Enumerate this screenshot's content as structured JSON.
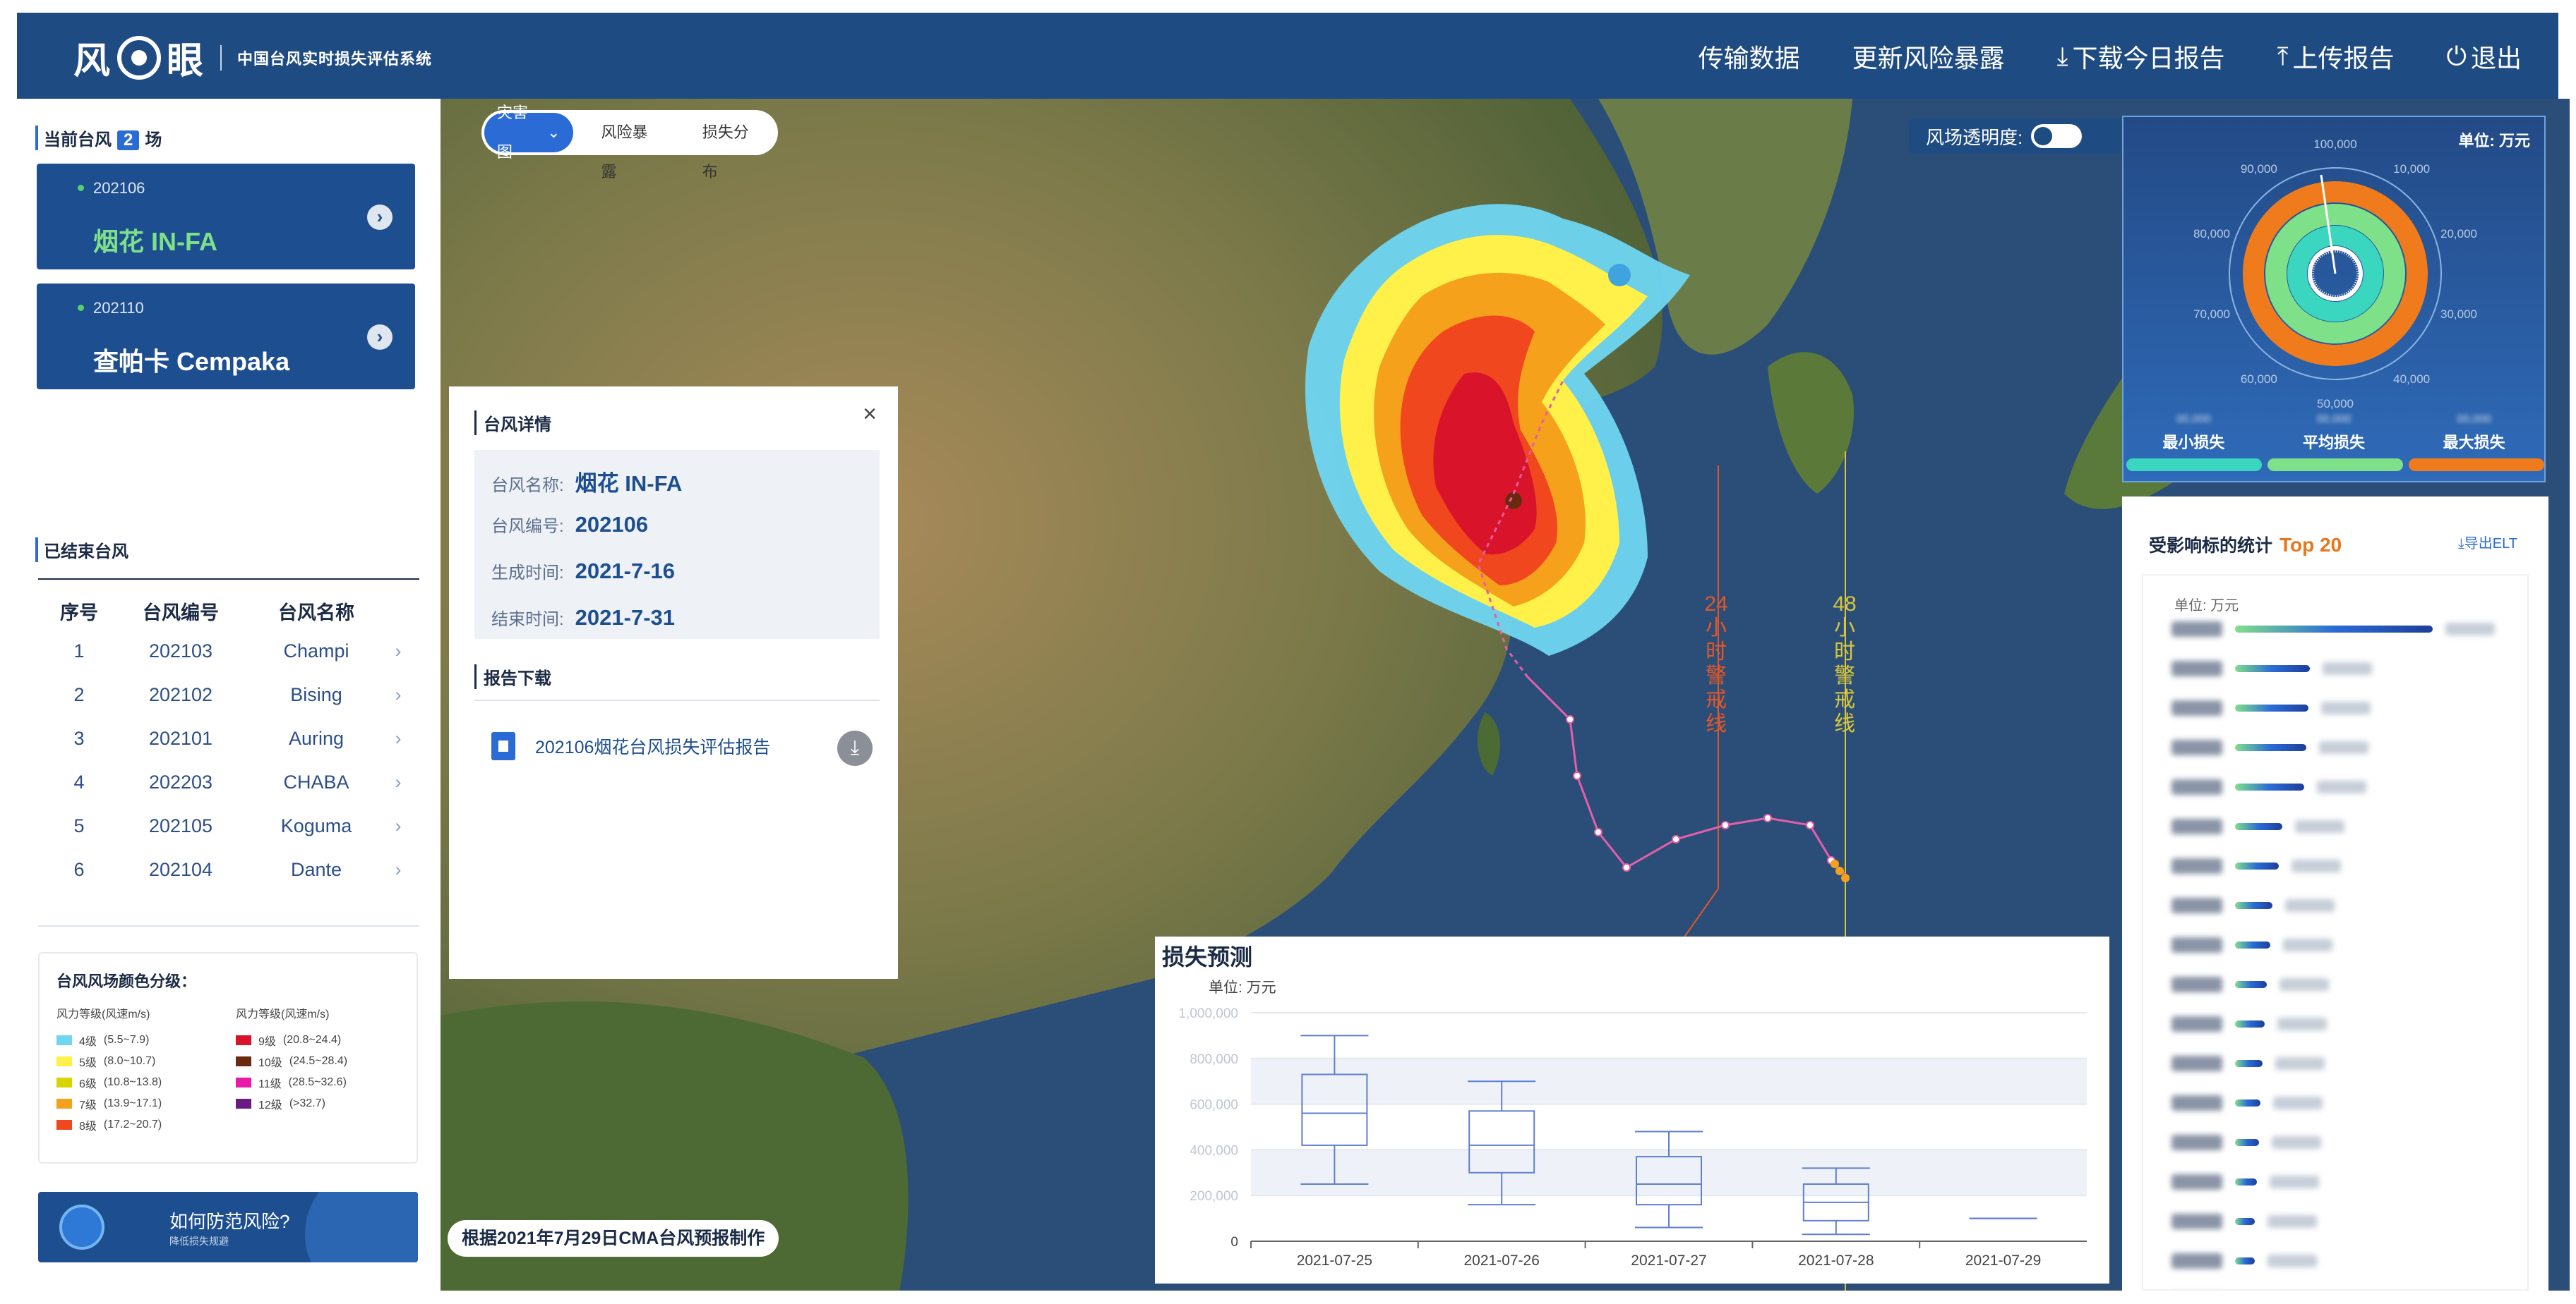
{
  "header": {
    "logo_left": "风",
    "logo_right": "眼",
    "system_name": "中国台风实时损失评估系统",
    "nav": [
      {
        "label": "传输数据",
        "icon": ""
      },
      {
        "label": "更新风险暴露",
        "icon": ""
      },
      {
        "label": "下载今日报告",
        "icon": "download-icon"
      },
      {
        "label": "上传报告",
        "icon": "upload-icon"
      },
      {
        "label": "退出",
        "icon": "power-icon"
      }
    ]
  },
  "current": {
    "title_prefix": "当前台风",
    "count": "2",
    "title_suffix": "场",
    "cards": [
      {
        "code": "202106",
        "name": "烟花 IN-FA",
        "name_color": "#7fe08a"
      },
      {
        "code": "202110",
        "name": "查帕卡 Cempaka",
        "name_color": "#ffffff"
      }
    ]
  },
  "ended": {
    "title": "已结束台风",
    "headers": [
      "序号",
      "台风编号",
      "台风名称"
    ],
    "rows": [
      [
        "1",
        "202103",
        "Champi"
      ],
      [
        "2",
        "202102",
        "Bising"
      ],
      [
        "3",
        "202101",
        "Auring"
      ],
      [
        "4",
        "202203",
        "CHABA"
      ],
      [
        "5",
        "202105",
        "Koguma"
      ],
      [
        "6",
        "202104",
        "Dante"
      ]
    ]
  },
  "legend": {
    "title": "台风风场颜色分级：",
    "col_header": "风力等级(风速m/s)",
    "left": [
      {
        "level": "4级",
        "range": "(5.5~7.9)",
        "color": "#6fd6f2"
      },
      {
        "level": "5级",
        "range": "(8.0~10.7)",
        "color": "#fff04a"
      },
      {
        "level": "6级",
        "range": "(10.8~13.8)",
        "color": "#d8d400"
      },
      {
        "level": "7级",
        "range": "(13.9~17.1)",
        "color": "#f5a11c"
      },
      {
        "level": "8级",
        "range": "(17.2~20.7)",
        "color": "#f0471f"
      }
    ],
    "right": [
      {
        "level": "9级",
        "range": "(20.8~24.4)",
        "color": "#d9142a"
      },
      {
        "level": "10级",
        "range": "(24.5~28.4)",
        "color": "#6b2a10"
      },
      {
        "level": "11级",
        "range": "(28.5~32.6)",
        "color": "#e81aa8"
      },
      {
        "level": "12级",
        "range": "(>32.7)",
        "color": "#6a1b82"
      }
    ]
  },
  "tip": {
    "title": "如何防范风险?",
    "subtitle": "降低损失规避"
  },
  "map": {
    "tabs": [
      "灾害图",
      "风险暴露",
      "损失分布"
    ],
    "opacity_label": "风场透明度:",
    "warning_24": "24小时警戒线",
    "warning_48": "48小时警戒线",
    "source": "根据2021年7月29日CMA台风预报制作"
  },
  "info": {
    "section1": "台风详情",
    "fields": [
      {
        "k": "台风名称:",
        "v": "烟花 IN-FA"
      },
      {
        "k": "台风编号:",
        "v": "202106"
      },
      {
        "k": "生成时间:",
        "v": "2021-7-16"
      },
      {
        "k": "结束时间:",
        "v": "2021-7-31"
      }
    ],
    "section2": "报告下载",
    "report": "202106烟花台风损失评估报告",
    "close": "×"
  },
  "forecast": {
    "title": "损失预测",
    "unit": "单位: 万元",
    "chart_data": {
      "type": "box",
      "categories": [
        "2021-07-25",
        "2021-07-26",
        "2021-07-27",
        "2021-07-28",
        "2021-07-29"
      ],
      "yticks": [
        "0",
        "200,000",
        "400,000",
        "600,000",
        "800,000",
        "1,000,000"
      ],
      "ylim": [
        0,
        1000000
      ],
      "boxes": [
        {
          "min": 250000,
          "q1": 420000,
          "median": 560000,
          "q3": 730000,
          "max": 900000
        },
        {
          "min": 160000,
          "q1": 300000,
          "median": 420000,
          "q3": 570000,
          "max": 700000
        },
        {
          "min": 60000,
          "q1": 160000,
          "median": 250000,
          "q3": 370000,
          "max": 480000
        },
        {
          "min": 30000,
          "q1": 90000,
          "median": 170000,
          "q3": 250000,
          "max": 320000
        },
        {
          "min": 100000,
          "q1": 100000,
          "median": 100000,
          "q3": 100000,
          "max": 100000
        }
      ]
    }
  },
  "gauge": {
    "unit": "单位: 万元",
    "labels": [
      "最小损失",
      "平均损失",
      "最大损失"
    ],
    "scale": [
      "100,000",
      "10,000",
      "20,000",
      "30,000",
      "40,000",
      "50,000",
      "60,000",
      "70,000",
      "80,000",
      "90,000"
    ],
    "bar_colors": [
      "#3ad6c0",
      "#7fe08a",
      "#f07b1c"
    ]
  },
  "stats": {
    "title": "受影响标的统计",
    "top": "Top 20",
    "export": "导出ELT",
    "unit": "单位: 万元",
    "bars": [
      1,
      0.38,
      0.37,
      0.36,
      0.35,
      0.24,
      0.22,
      0.19,
      0.18,
      0.16,
      0.15,
      0.14,
      0.13,
      0.12,
      0.11,
      0.1,
      0.1,
      0.09
    ]
  }
}
